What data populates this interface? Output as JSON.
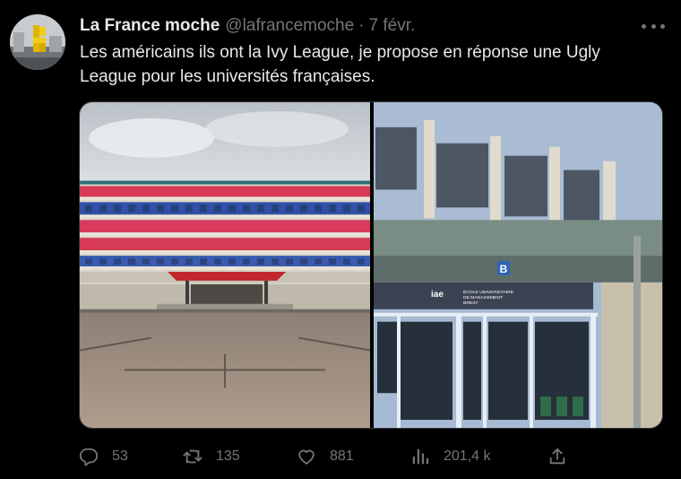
{
  "tweet": {
    "author_name": "La France moche",
    "handle": "@lafrancemoche",
    "separator": "·",
    "time": "7 févr.",
    "text": "Les américains ils ont la Ivy League, je propose en réponse une Ugly League pour les universités françaises."
  },
  "icons": {
    "more": "more-dots-icon",
    "reply": "reply-icon",
    "retweet": "retweet-icon",
    "like": "heart-icon",
    "views": "views-icon",
    "share": "share-icon"
  },
  "actions": {
    "replies": "53",
    "retweets": "135",
    "likes": "881",
    "views": "201,4 k"
  },
  "photo_right": {
    "sign_letter": "B",
    "logo_text": "iae",
    "sign_line1": "ÉCOLE UNIVERSITAIRE",
    "sign_line2": "DE MANAGEMENT",
    "sign_line3": "BREST"
  },
  "colors": {
    "background": "#000000",
    "text": "#e7e9ea",
    "muted": "#71767b"
  }
}
